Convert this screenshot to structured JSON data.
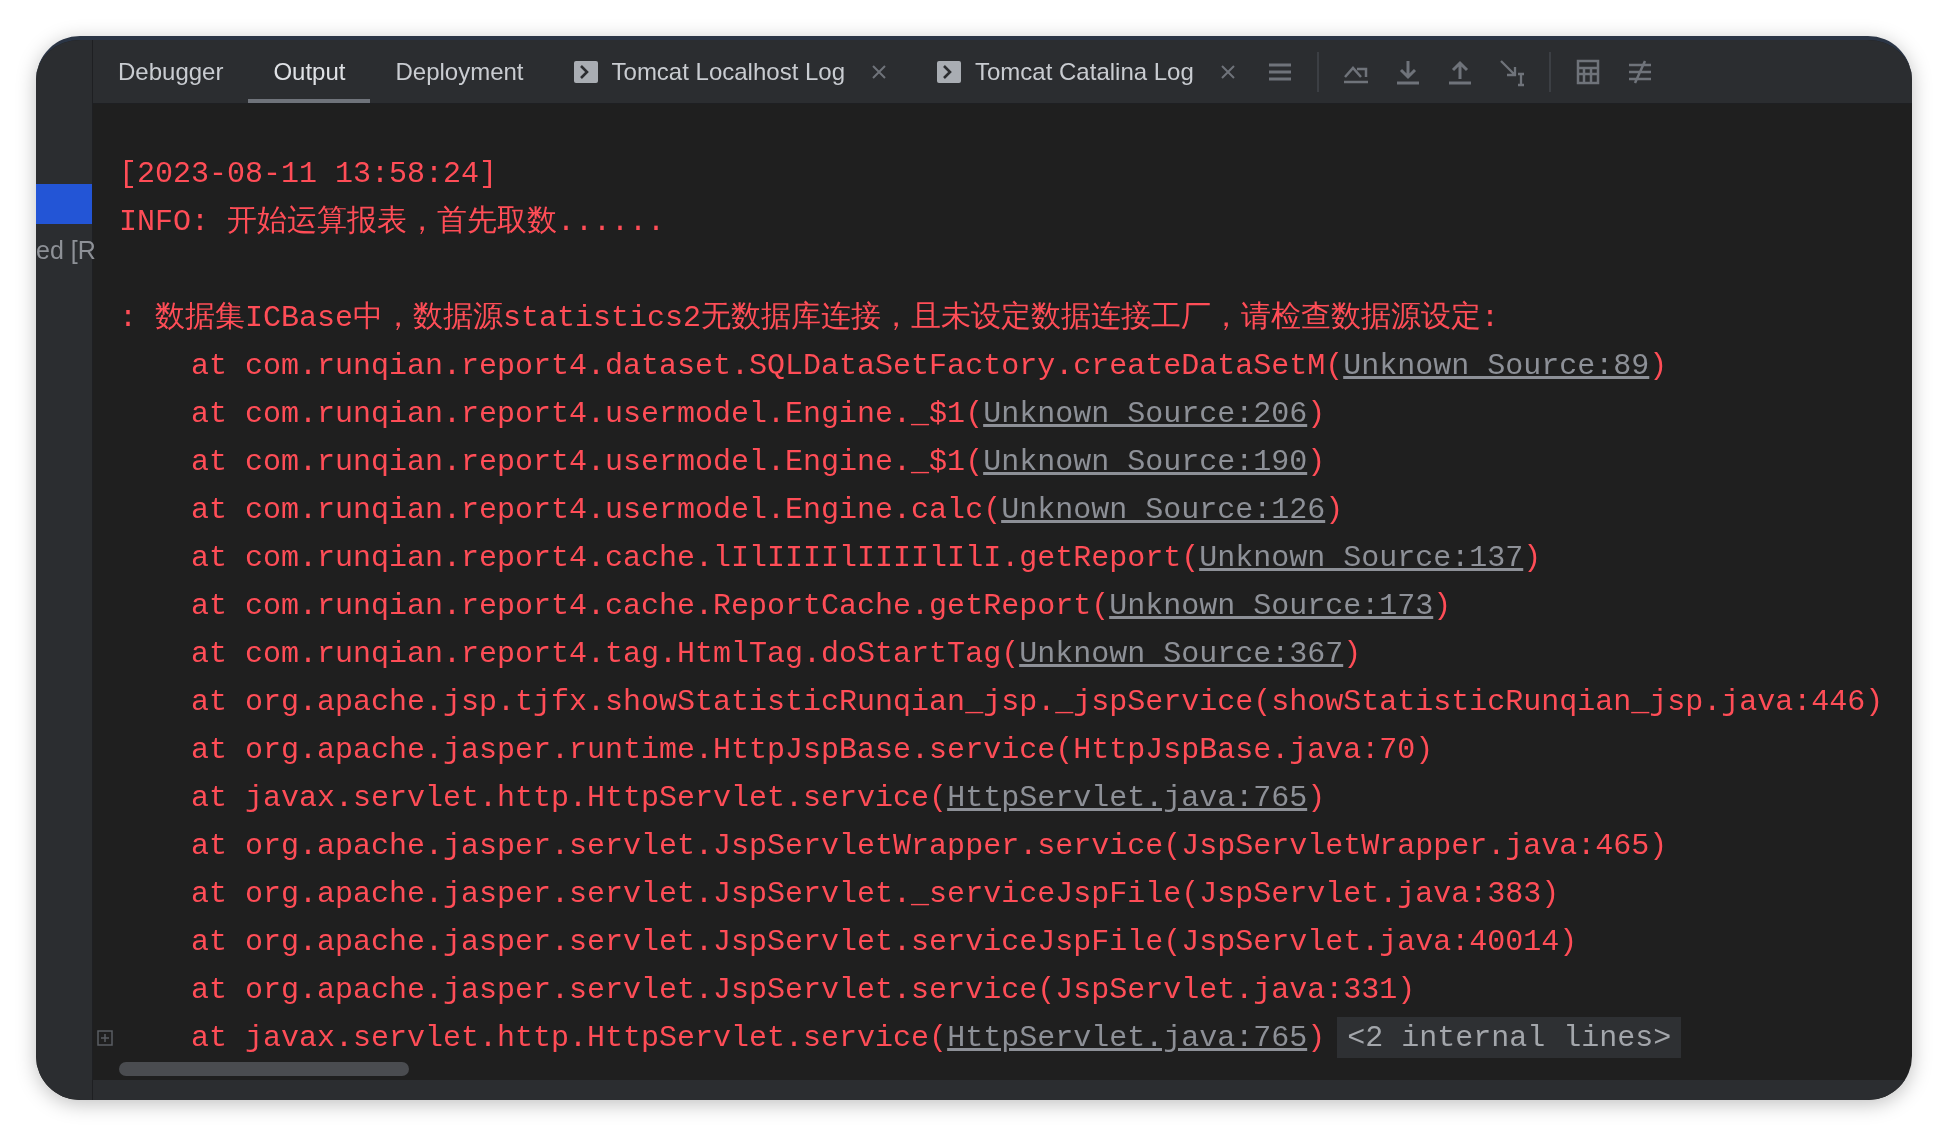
{
  "sidebar": {
    "label": "ed [R"
  },
  "tabs": [
    {
      "label": "Debugger",
      "selected": false,
      "closable": false,
      "kind": "plain"
    },
    {
      "label": "Output",
      "selected": true,
      "closable": false,
      "kind": "plain"
    },
    {
      "label": "Deployment",
      "selected": false,
      "closable": false,
      "kind": "plain"
    },
    {
      "label": "Tomcat Localhost Log",
      "selected": false,
      "closable": true,
      "kind": "log"
    },
    {
      "label": "Tomcat Catalina Log",
      "selected": false,
      "closable": true,
      "kind": "log"
    }
  ],
  "lines": [
    {
      "kind": "message",
      "text": "[2023-08-11 13:58:24]"
    },
    {
      "kind": "message",
      "text": "INFO: 开始运算报表，首先取数......"
    },
    {
      "kind": "blank"
    },
    {
      "kind": "message",
      "text": ": 数据集ICBase中，数据源statistics2无数据库连接，且未设定数据连接工厂，请检查数据源设定:"
    },
    {
      "kind": "frame",
      "text": "at com.runqian.report4.dataset.SQLDataSetFactory.createDataSetM(",
      "link": "Unknown Source:89",
      "tail": ")"
    },
    {
      "kind": "frame",
      "text": "at com.runqian.report4.usermodel.Engine._$1(",
      "link": "Unknown Source:206",
      "tail": ")"
    },
    {
      "kind": "frame",
      "text": "at com.runqian.report4.usermodel.Engine._$1(",
      "link": "Unknown Source:190",
      "tail": ")"
    },
    {
      "kind": "frame",
      "text": "at com.runqian.report4.usermodel.Engine.calc(",
      "link": "Unknown Source:126",
      "tail": ")"
    },
    {
      "kind": "frame",
      "text": "at com.runqian.report4.cache.lIlIIIIlIIIIlIlI.getReport(",
      "link": "Unknown Source:137",
      "tail": ")"
    },
    {
      "kind": "frame",
      "text": "at com.runqian.report4.cache.ReportCache.getReport(",
      "link": "Unknown Source:173",
      "tail": ")"
    },
    {
      "kind": "frame",
      "text": "at com.runqian.report4.tag.HtmlTag.doStartTag(",
      "link": "Unknown Source:367",
      "tail": ")"
    },
    {
      "kind": "frame",
      "text": "at org.apache.jsp.tjfx.showStatisticRunqian_jsp._jspService(showStatisticRunqian_jsp.java:446)"
    },
    {
      "kind": "frame",
      "text": "at org.apache.jasper.runtime.HttpJspBase.service(HttpJspBase.java:70)"
    },
    {
      "kind": "frame",
      "text": "at javax.servlet.http.HttpServlet.service(",
      "link": "HttpServlet.java:765",
      "tail": ")"
    },
    {
      "kind": "frame",
      "text": "at org.apache.jasper.servlet.JspServletWrapper.service(JspServletWrapper.java:465)"
    },
    {
      "kind": "frame",
      "text": "at org.apache.jasper.servlet.JspServlet._serviceJspFile(JspServlet.java:383)"
    },
    {
      "kind": "frame",
      "text": "at org.apache.jasper.servlet.JspServlet.serviceJspFile(JspServlet.java:40014)"
    },
    {
      "kind": "frame",
      "text": "at org.apache.jasper.servlet.JspServlet.service(JspServlet.java:331)"
    },
    {
      "kind": "frame",
      "text": "at javax.servlet.http.HttpServlet.service(",
      "link": "HttpServlet.java:765",
      "tail": ")",
      "fold": {
        "label": "<2 internal lines>",
        "expanded": false
      }
    }
  ]
}
